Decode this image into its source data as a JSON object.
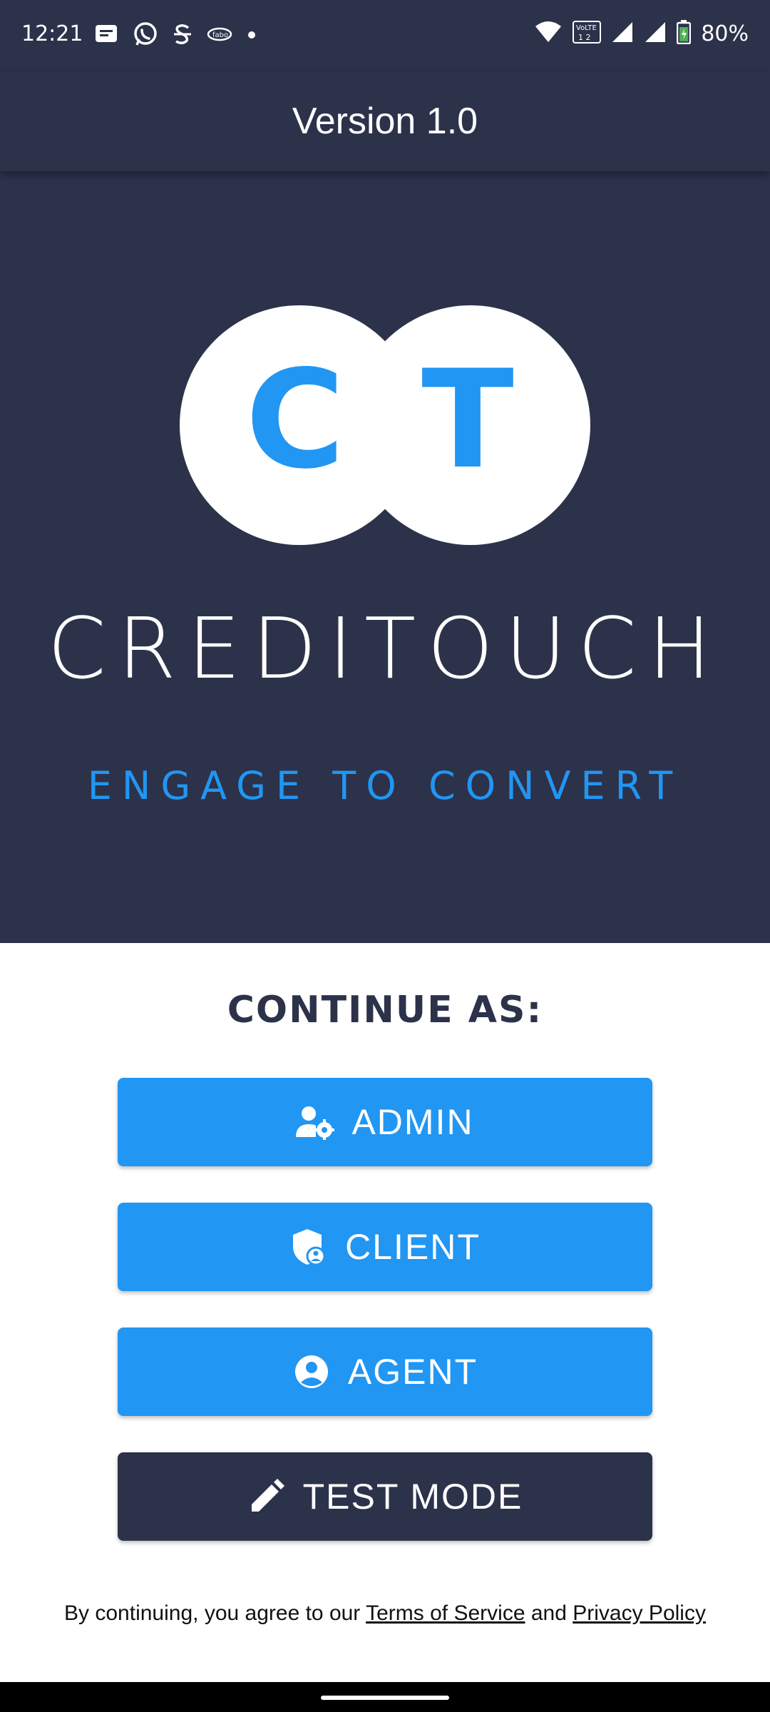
{
  "status_bar": {
    "time": "12:21",
    "battery": "80%",
    "icons_left": [
      "message-icon",
      "whatsapp-icon",
      "s-app-icon",
      "fabo-app-icon",
      "dot-icon"
    ],
    "icons_right": [
      "wifi-icon",
      "volte-icon",
      "signal-icon",
      "signal-icon",
      "battery-icon"
    ]
  },
  "app_bar": {
    "title": "Version 1.0"
  },
  "logo": {
    "letters": [
      "C",
      "T"
    ],
    "brand": "CREDITOUCH",
    "tagline": "ENGAGE TO CONVERT"
  },
  "continue": {
    "heading": "CONTINUE AS:"
  },
  "buttons": {
    "admin": {
      "label": "ADMIN",
      "icon": "admin-settings-icon"
    },
    "client": {
      "label": "CLIENT",
      "icon": "shield-user-icon"
    },
    "agent": {
      "label": "AGENT",
      "icon": "account-circle-icon"
    },
    "test_mode": {
      "label": "TEST MODE",
      "icon": "pencil-icon"
    }
  },
  "terms": {
    "prefix": "By continuing, you agree to our",
    "tos": "Terms of Service",
    "and": "and",
    "privacy": "Privacy Policy"
  },
  "colors": {
    "navy": "#2c324a",
    "accent_blue": "#2196f3",
    "white": "#ffffff"
  }
}
